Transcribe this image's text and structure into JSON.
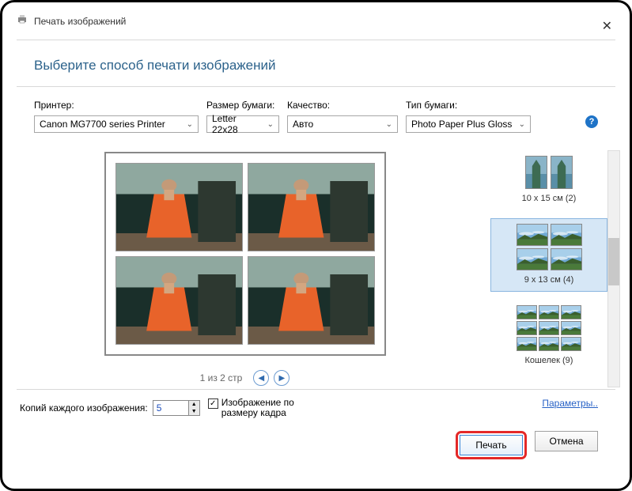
{
  "window": {
    "title": "Печать изображений",
    "heading": "Выберите способ печати изображений"
  },
  "controls": {
    "printer": {
      "label": "Принтер:",
      "value": "Canon MG7700 series Printer"
    },
    "paper_size": {
      "label": "Размер бумаги:",
      "value": "Letter 22x28"
    },
    "quality": {
      "label": "Качество:",
      "value": "Авто"
    },
    "paper_type": {
      "label": "Тип бумаги:",
      "value": "Photo Paper Plus Gloss"
    }
  },
  "preview": {
    "pager_text": "1 из 2 стр"
  },
  "layouts": {
    "opt1": "10 x 15 см (2)",
    "opt2": "9 x 13 см (4)",
    "opt3": "Кошелек (9)"
  },
  "bottom": {
    "copies_label": "Копий каждого изображения:",
    "copies_value": "5",
    "fit_label": "Изображение по\nразмеру кадра",
    "options_link": "Параметры..",
    "print_btn": "Печать",
    "cancel_btn": "Отмена"
  }
}
